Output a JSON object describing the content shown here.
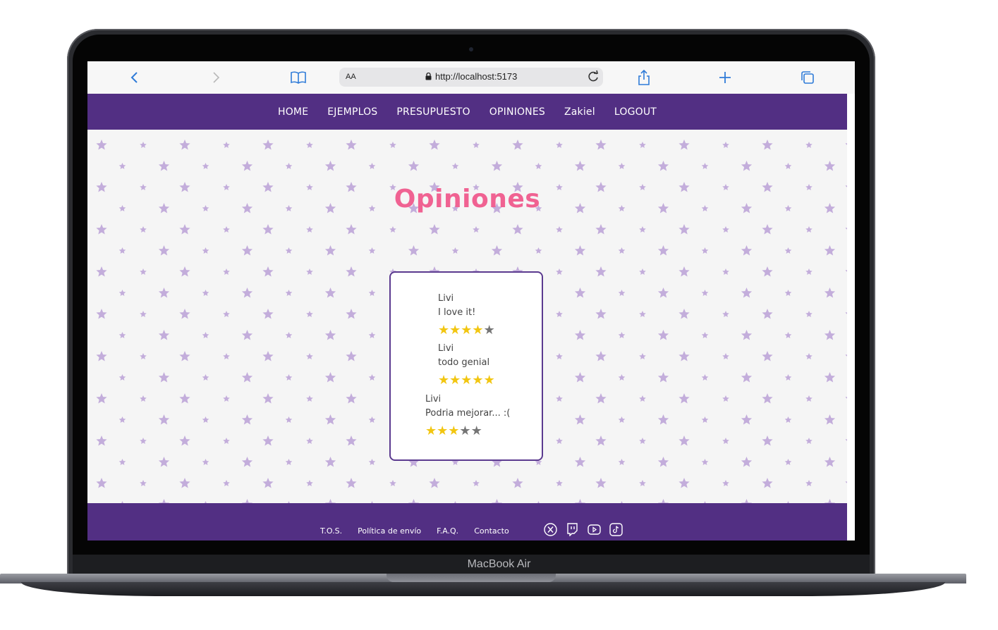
{
  "device": {
    "label": "MacBook Air"
  },
  "browser": {
    "text_size_label": "AA",
    "url": "http://localhost:5173"
  },
  "nav": {
    "items": [
      "HOME",
      "EJEMPLOS",
      "PRESUPUESTO",
      "OPINIONES",
      "Zakiel",
      "LOGOUT"
    ]
  },
  "page": {
    "title": "Opiniones"
  },
  "reviews": [
    {
      "name": "Livi",
      "text": "I love it!",
      "rating": 4,
      "max": 5
    },
    {
      "name": "Livi",
      "text": "todo genial",
      "rating": 5,
      "max": 5
    },
    {
      "name": "Livi",
      "text": "Podria mejorar... :(",
      "rating": 3,
      "max": 5
    }
  ],
  "footer": {
    "links": [
      "T.O.S.",
      "Política de envío",
      "F.A.Q.",
      "Contacto"
    ],
    "socials": [
      "x-icon",
      "twitch-icon",
      "youtube-icon",
      "tiktok-icon"
    ]
  },
  "colors": {
    "nav_bg": "#522f83",
    "title": "#f06292",
    "star_on": "#f2c611",
    "star_off": "#757575",
    "pattern_star": "#c3addb"
  }
}
